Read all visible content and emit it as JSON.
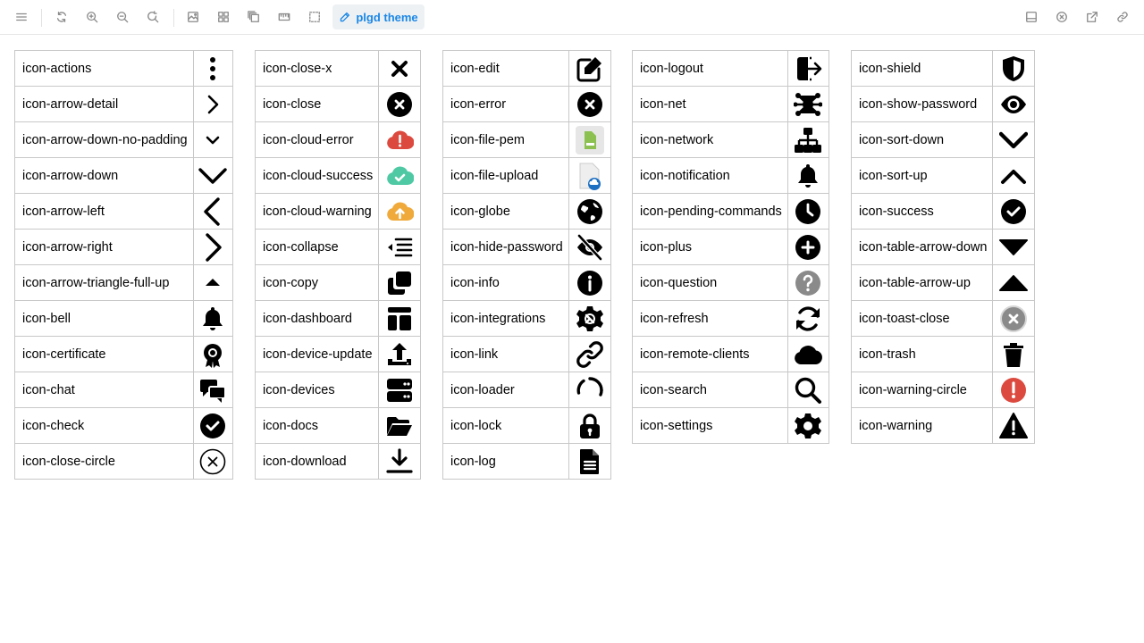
{
  "toolbar": {
    "left_buttons": [
      "menu-icon",
      "sync-icon",
      "zoom-in-icon",
      "zoom-out-icon",
      "zoom-reset-icon",
      "image-icon",
      "grid-icon",
      "layers-icon",
      "ruler-icon",
      "selection-icon"
    ],
    "theme_label": "plgd theme",
    "right_buttons": [
      "panel-icon",
      "close-circle-icon",
      "external-link-icon",
      "link-icon"
    ],
    "accent_color": "#1b87e6"
  },
  "columns": [
    {
      "rows": [
        {
          "name": "icon-actions",
          "icon": "actions"
        },
        {
          "name": "icon-arrow-detail",
          "icon": "arrow-detail"
        },
        {
          "name": "icon-arrow-down-no-padding",
          "icon": "arrow-down-small"
        },
        {
          "name": "icon-arrow-down",
          "icon": "arrow-down"
        },
        {
          "name": "icon-arrow-left",
          "icon": "arrow-left"
        },
        {
          "name": "icon-arrow-right",
          "icon": "arrow-right"
        },
        {
          "name": "icon-arrow-triangle-full-up",
          "icon": "triangle-up-small"
        },
        {
          "name": "icon-bell",
          "icon": "bell"
        },
        {
          "name": "icon-certificate",
          "icon": "certificate"
        },
        {
          "name": "icon-chat",
          "icon": "chat"
        },
        {
          "name": "icon-check",
          "icon": "check-circle"
        },
        {
          "name": "icon-close-circle",
          "icon": "close-circle-outline"
        }
      ]
    },
    {
      "rows": [
        {
          "name": "icon-close-x",
          "icon": "close-x"
        },
        {
          "name": "icon-close",
          "icon": "close-filled"
        },
        {
          "name": "icon-cloud-error",
          "icon": "cloud-error"
        },
        {
          "name": "icon-cloud-success",
          "icon": "cloud-success"
        },
        {
          "name": "icon-cloud-warning",
          "icon": "cloud-warning"
        },
        {
          "name": "icon-collapse",
          "icon": "collapse"
        },
        {
          "name": "icon-copy",
          "icon": "copy"
        },
        {
          "name": "icon-dashboard",
          "icon": "dashboard"
        },
        {
          "name": "icon-device-update",
          "icon": "device-update"
        },
        {
          "name": "icon-devices",
          "icon": "devices"
        },
        {
          "name": "icon-docs",
          "icon": "docs"
        },
        {
          "name": "icon-download",
          "icon": "download"
        }
      ]
    },
    {
      "rows": [
        {
          "name": "icon-edit",
          "icon": "edit"
        },
        {
          "name": "icon-error",
          "icon": "close-filled"
        },
        {
          "name": "icon-file-pem",
          "icon": "file-pem"
        },
        {
          "name": "icon-file-upload",
          "icon": "file-upload"
        },
        {
          "name": "icon-globe",
          "icon": "globe"
        },
        {
          "name": "icon-hide-password",
          "icon": "hide-password"
        },
        {
          "name": "icon-info",
          "icon": "info"
        },
        {
          "name": "icon-integrations",
          "icon": "integrations"
        },
        {
          "name": "icon-link",
          "icon": "link"
        },
        {
          "name": "icon-loader",
          "icon": "loader"
        },
        {
          "name": "icon-lock",
          "icon": "lock"
        },
        {
          "name": "icon-log",
          "icon": "log"
        }
      ]
    },
    {
      "rows": [
        {
          "name": "icon-logout",
          "icon": "logout"
        },
        {
          "name": "icon-net",
          "icon": "net"
        },
        {
          "name": "icon-network",
          "icon": "network"
        },
        {
          "name": "icon-notification",
          "icon": "bell"
        },
        {
          "name": "icon-pending-commands",
          "icon": "clock"
        },
        {
          "name": "icon-plus",
          "icon": "plus-circle"
        },
        {
          "name": "icon-question",
          "icon": "question"
        },
        {
          "name": "icon-refresh",
          "icon": "refresh"
        },
        {
          "name": "icon-remote-clients",
          "icon": "cloud"
        },
        {
          "name": "icon-search",
          "icon": "search"
        },
        {
          "name": "icon-settings",
          "icon": "settings"
        }
      ]
    },
    {
      "rows": [
        {
          "name": "icon-shield",
          "icon": "shield"
        },
        {
          "name": "icon-show-password",
          "icon": "eye"
        },
        {
          "name": "icon-sort-down",
          "icon": "sort-down"
        },
        {
          "name": "icon-sort-up",
          "icon": "sort-up"
        },
        {
          "name": "icon-success",
          "icon": "check-circle"
        },
        {
          "name": "icon-table-arrow-down",
          "icon": "table-arrow-down"
        },
        {
          "name": "icon-table-arrow-up",
          "icon": "table-arrow-up"
        },
        {
          "name": "icon-toast-close",
          "icon": "toast-close"
        },
        {
          "name": "icon-trash",
          "icon": "trash"
        },
        {
          "name": "icon-warning-circle",
          "icon": "warning-circle"
        },
        {
          "name": "icon-warning",
          "icon": "warning"
        }
      ]
    }
  ],
  "colors": {
    "error_red": "#dc4a3f",
    "success_green": "#4fc9a4",
    "warning_orange": "#f0a93b",
    "pem_green": "#8cc152",
    "upload_blue": "#1d6fc2",
    "question_gray": "#8a8a8a",
    "toast_gray": "#8a8a8a"
  }
}
